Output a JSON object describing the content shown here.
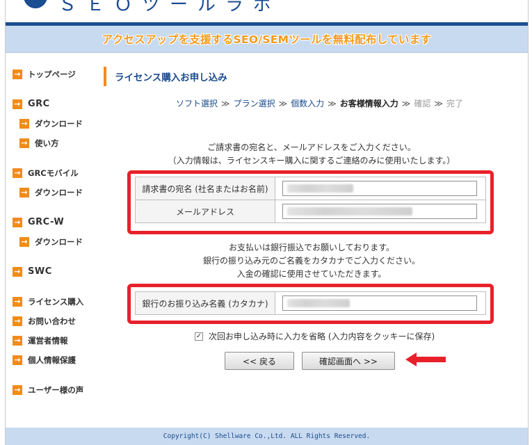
{
  "banner": {
    "text": "アクセスアップを支援するSEO/SEMツールを無料配布しています"
  },
  "logo": {
    "text": "ＳＥＯツールラボ"
  },
  "sidebar": {
    "items": [
      {
        "label": "トップページ"
      },
      {
        "label": "GRC"
      },
      {
        "label": "ダウンロード"
      },
      {
        "label": "使い方"
      },
      {
        "label": "GRCモバイル"
      },
      {
        "label": "ダウンロード"
      },
      {
        "label": "GRC-W"
      },
      {
        "label": "ダウンロード"
      },
      {
        "label": "SWC"
      },
      {
        "label": "ライセンス購入"
      },
      {
        "label": "お問い合わせ"
      },
      {
        "label": "運営者情報"
      },
      {
        "label": "個人情報保護"
      },
      {
        "label": "ユーザー様の声"
      }
    ]
  },
  "main": {
    "section_title": "ライセンス購入お申し込み",
    "steps": {
      "items": [
        "ソフト選択",
        "プラン選択",
        "個数入力",
        "お客様情報入力",
        "確認",
        "完了"
      ],
      "separator": "≫"
    },
    "notice1": {
      "line1": "ご請求書の宛名と、メールアドレスをご入力ください。",
      "line2": "（入力情報は、ライセンスキー購入に関するご連絡のみに使用いたします。）"
    },
    "form1": {
      "name_label": "請求書の宛名 (社名またはお名前)",
      "email_label": "メールアドレス"
    },
    "notice2": {
      "line1": "お支払いは銀行振込でお願いしております。",
      "line2": "銀行の振り込み元のご名義をカタカナでご入力ください。",
      "line3": "入金の確認に使用させていただきます。"
    },
    "form2": {
      "bank_label": "銀行のお振り込み名義 (カタカナ)"
    },
    "checkbox": {
      "label": "次回お申し込み時に入力を省略 (入力内容をクッキーに保存)",
      "checked": "✓"
    },
    "buttons": {
      "back": "<< 戻る",
      "next": "確認画面へ >>"
    }
  },
  "footer": {
    "copyright": "Copyright(C) Shellware Co.,Ltd. ALL Rights Reserved."
  },
  "colors": {
    "brand": "#1b4d92",
    "accent": "#f08c1a",
    "highlight": "#e8202a",
    "banner_bg": "#c8daf0"
  },
  "icons": {
    "nav_arrow": "arrow-right-icon",
    "annotation_arrow": "red-arrow-icon"
  }
}
